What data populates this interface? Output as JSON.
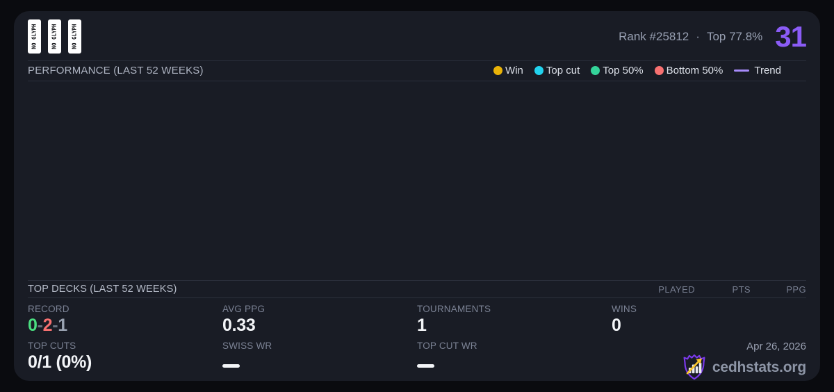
{
  "colors": {
    "card_bg": "#191c25",
    "page_bg": "#0a0b0f",
    "accent_purple": "#8b5cf6",
    "win_yellow": "#eab308",
    "topcut_cyan": "#22d3ee",
    "top50_green": "#34d399",
    "bottom50_red": "#f87171",
    "trend_purple": "#a78bfa",
    "record_win_green": "#4ade80",
    "record_loss_red": "#f87171"
  },
  "header": {
    "glyphs": [
      "NO GLYPH",
      "NO GLYPH",
      "NO GLYPH"
    ],
    "rank_label": "Rank #25812",
    "dot_separator": "·",
    "top_percent_label": "Top 77.8%",
    "points": "31"
  },
  "performance": {
    "title": "PERFORMANCE (LAST 52 WEEKS)",
    "legend": [
      {
        "label": "Win",
        "color": "#eab308",
        "type": "dot"
      },
      {
        "label": "Top cut",
        "color": "#22d3ee",
        "type": "dot"
      },
      {
        "label": "Top 50%",
        "color": "#34d399",
        "type": "dot"
      },
      {
        "label": "Bottom 50%",
        "color": "#f87171",
        "type": "dot"
      },
      {
        "label": "Trend",
        "color": "#a78bfa",
        "type": "line"
      }
    ],
    "chart": {
      "type": "scatter",
      "points": [],
      "empty": true
    }
  },
  "top_decks": {
    "title": "TOP DECKS (LAST 52 WEEKS)",
    "columns": [
      "PLAYED",
      "PTS",
      "PPG"
    ],
    "rows": []
  },
  "stats": {
    "record": {
      "label": "RECORD",
      "wins": "0",
      "sep1": "-",
      "losses": "2",
      "sep2": "-",
      "draws": "1"
    },
    "avg_ppg": {
      "label": "AVG PPG",
      "value": "0.33"
    },
    "tournaments": {
      "label": "TOURNAMENTS",
      "value": "1"
    },
    "wins": {
      "label": "WINS",
      "value": "0"
    },
    "top_cuts": {
      "label": "TOP CUTS",
      "value": "0/1 (0%)"
    },
    "swiss_wr": {
      "label": "SWISS WR",
      "value": "—"
    },
    "top_cut_wr": {
      "label": "TOP CUT WR",
      "value": "—"
    }
  },
  "footer": {
    "date": "Apr 26, 2026",
    "brand": "cedhstats.org"
  }
}
